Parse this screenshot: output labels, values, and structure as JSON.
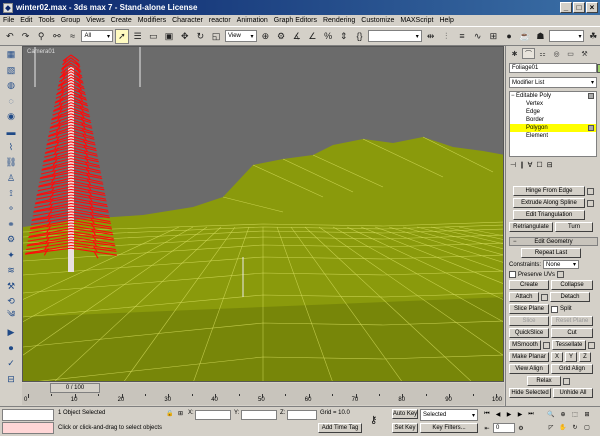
{
  "window": {
    "title": "winter02.max - 3ds max 7 - Stand-alone License",
    "min": "_",
    "max": "□",
    "close": "×"
  },
  "menu": [
    "File",
    "Edit",
    "Tools",
    "Group",
    "Views",
    "Create",
    "Modifiers",
    "Character",
    "reactor",
    "Animation",
    "Graph Editors",
    "Rendering",
    "Customize",
    "MAXScript",
    "Help"
  ],
  "toolbar": {
    "selection_filter": "All",
    "reference_coord": "View"
  },
  "viewport": {
    "label": "Camera01",
    "colors": {
      "sky": "#6b6b6b",
      "terrain": "#8a9a0c",
      "wire": "#d8e060",
      "tree": "#ff0a0a"
    }
  },
  "timeline": {
    "slider_label": "0 / 100",
    "ticks": [
      "0",
      "10",
      "20",
      "30",
      "40",
      "50",
      "60",
      "70",
      "80",
      "90",
      "100"
    ]
  },
  "command_panel": {
    "object_name": "Foliage01",
    "modifier_list": "Modifier List",
    "stack": {
      "root": "Editable Poly",
      "items": [
        "Vertex",
        "Edge",
        "Border",
        "Polygon",
        "Element"
      ],
      "selected": "Polygon"
    },
    "edit_faces": {
      "hinge_from_edge": "Hinge From Edge",
      "extrude_along_spline": "Extrude Along Spline",
      "edit_triangulation": "Edit Triangulation",
      "retriangulate": "Retriangulate",
      "turn": "Turn"
    },
    "edit_geometry": {
      "header": "Edit Geometry",
      "repeat_last": "Repeat Last",
      "constraints_label": "Constraints:",
      "constraints_value": "None",
      "preserve_uvs": "Preserve UVs",
      "create": "Create",
      "collapse": "Collapse",
      "attach": "Attach",
      "detach": "Detach",
      "slice_plane": "Slice Plane",
      "split": "Split",
      "slice": "Slice",
      "reset_plane": "Reset Plane",
      "quickslice": "QuickSlice",
      "cut": "Cut",
      "msmooth": "MSmooth",
      "tessellate": "Tessellate",
      "make_planar": "Make Planar",
      "x": "X",
      "y": "Y",
      "z": "Z",
      "view_align": "View Align",
      "grid_align": "Grid Align",
      "relax": "Relax",
      "hide_selected": "Hide Selected",
      "unhide_all": "Unhide All"
    }
  },
  "status": {
    "selection": "1 Object Selected",
    "prompt": "Click or click-and-drag to select objects",
    "x_label": "X:",
    "y_label": "Y:",
    "z_label": "Z:",
    "grid": "Grid = 10.0",
    "add_time_tag": "Add Time Tag",
    "auto_key": "Auto Key",
    "auto_key_mode": "Selected",
    "set_key": "Set Key",
    "key_filters": "Key Filters...",
    "frame": "0"
  }
}
